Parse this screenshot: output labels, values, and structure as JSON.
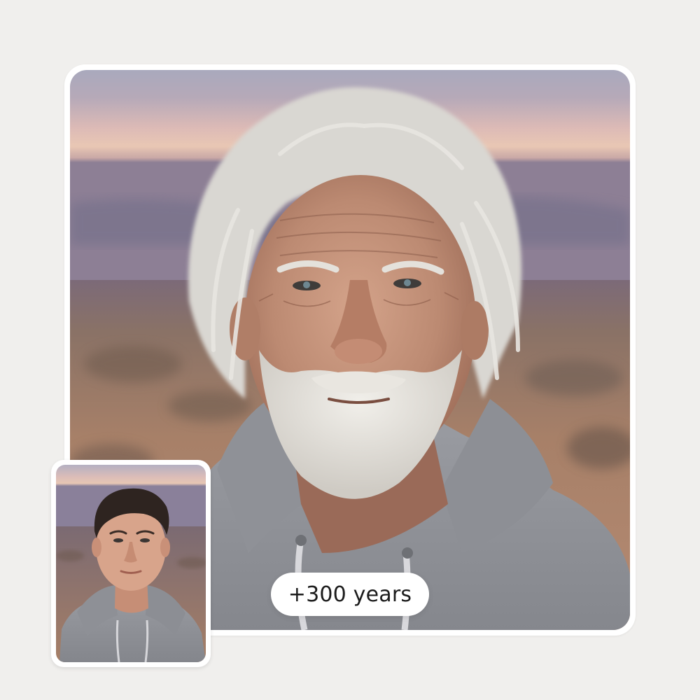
{
  "app": {
    "description_badge": "+300 years"
  },
  "after_photo": {
    "subject": "elderly-man-portrait",
    "background": "desert-dusk"
  },
  "before_photo": {
    "subject": "young-man-portrait",
    "background": "desert-dusk"
  },
  "colors": {
    "page_background": "#f0efed",
    "card_background": "#ffffff",
    "badge_text": "#1b1b1b"
  }
}
